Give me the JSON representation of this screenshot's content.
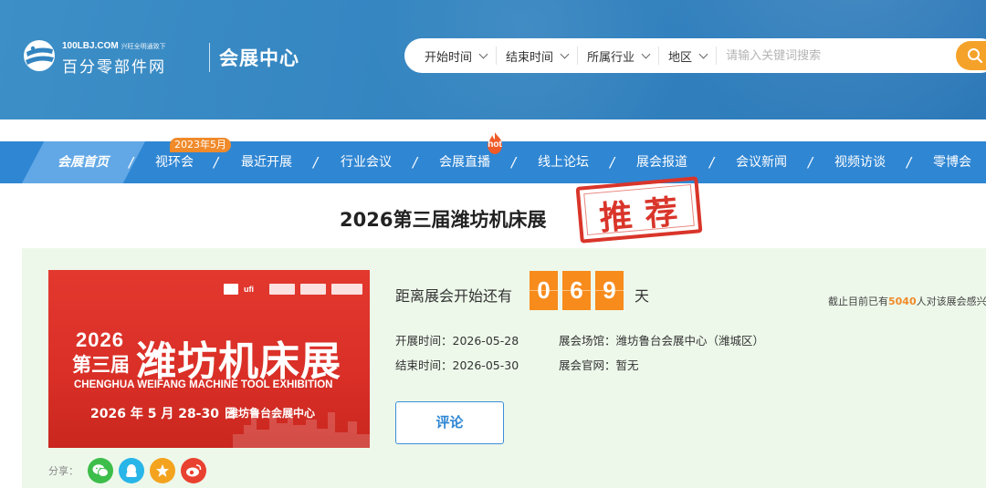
{
  "header": {
    "logo_domain": "100LBJ.COM",
    "logo_slogan": "兴旺全明通致下",
    "logo_name": "百分零部件网",
    "section_name": "会展中心"
  },
  "search": {
    "filters": [
      {
        "label": "开始时间"
      },
      {
        "label": "结束时间"
      },
      {
        "label": "所属行业"
      },
      {
        "label": "地区"
      }
    ],
    "placeholder": "请输入关键词搜索",
    "icon": "search-icon"
  },
  "nav": {
    "items": [
      {
        "label": "会展首页",
        "active": true
      },
      {
        "label": "视环会"
      },
      {
        "label": "最近开展"
      },
      {
        "label": "行业会议"
      },
      {
        "label": "会展直播"
      },
      {
        "label": "线上论坛"
      },
      {
        "label": "展会报道"
      },
      {
        "label": "会议新闻"
      },
      {
        "label": "视频访谈"
      },
      {
        "label": "零博会"
      }
    ],
    "badge": "2023年5月",
    "hot": "hot"
  },
  "expo": {
    "title": "2026第三届潍坊机床展",
    "stamp": "推荐",
    "countdown_label": "距离展会开始还有",
    "countdown_digits": [
      "0",
      "6",
      "9"
    ],
    "countdown_unit": "天",
    "start_label": "开展时间：2026-05-28",
    "end_label": "结束时间：2026-05-30",
    "venue_label": "展会场馆：潍坊鲁台会展中心（潍城区）",
    "website_label": "展会官网：暂无",
    "interest_prefix": "截止目前已有",
    "interest_count": "5040",
    "interest_suffix": "人对该展会感兴",
    "comment_button": "评论",
    "share_label": "分享："
  },
  "poster": {
    "year": "2026",
    "session": "第三届",
    "name": "潍坊机床展",
    "english": "CHENGHUA WEIFANG MACHINE TOOL EXHIBITION",
    "date": "2026 年 5 月 28-30 日",
    "venue": "潍坊鲁台会展中心",
    "logo_text": "ufi"
  },
  "colors": {
    "banner": "#3384c0",
    "nav": "#2f86d3",
    "nav_active": "#62a8e6",
    "accent_orange": "#f78b1c",
    "stamp_red": "#d9352a",
    "panel_bg": "#edf8ea"
  }
}
